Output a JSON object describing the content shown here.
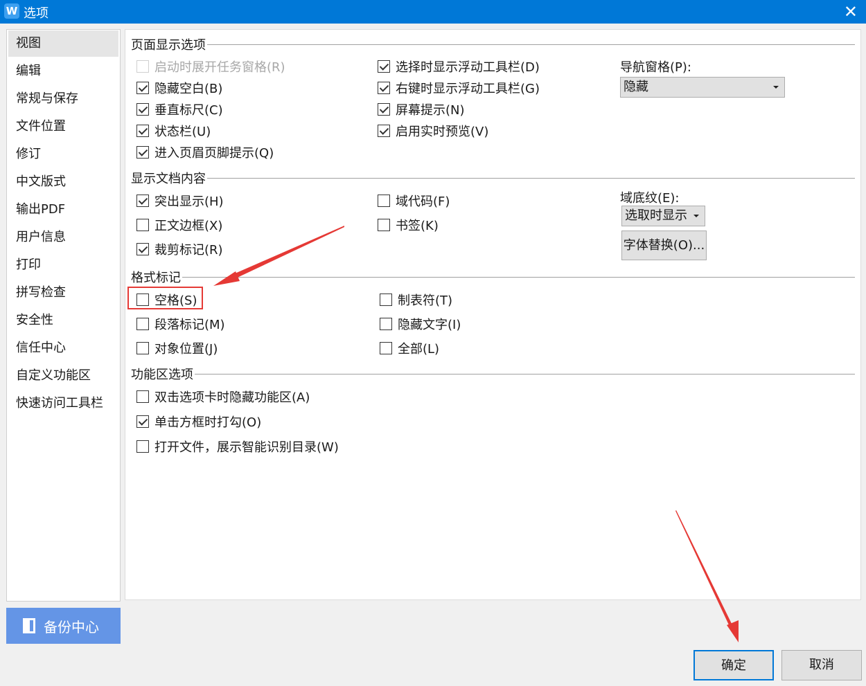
{
  "window": {
    "title": "选项",
    "close": "✕",
    "app_icon": "W"
  },
  "sidebar": {
    "items": [
      {
        "label": "视图",
        "selected": true
      },
      {
        "label": "编辑"
      },
      {
        "label": "常规与保存"
      },
      {
        "label": "文件位置"
      },
      {
        "label": "修订"
      },
      {
        "label": "中文版式"
      },
      {
        "label": "输出PDF"
      },
      {
        "label": "用户信息"
      },
      {
        "label": "打印"
      },
      {
        "label": "拼写检查"
      },
      {
        "label": "安全性"
      },
      {
        "label": "信任中心"
      },
      {
        "label": "自定义功能区"
      },
      {
        "label": "快速访问工具栏"
      }
    ]
  },
  "page_display": {
    "title": "页面显示选项",
    "left": [
      {
        "label": "启动时展开任务窗格(R)",
        "checked": false,
        "disabled": true
      },
      {
        "label": "隐藏空白(B)",
        "checked": true
      },
      {
        "label": "垂直标尺(C)",
        "checked": true
      },
      {
        "label": "状态栏(U)",
        "checked": true
      },
      {
        "label": "进入页眉页脚提示(Q)",
        "checked": true
      }
    ],
    "right": [
      {
        "label": "选择时显示浮动工具栏(D)",
        "checked": true
      },
      {
        "label": "右键时显示浮动工具栏(G)",
        "checked": true
      },
      {
        "label": "屏幕提示(N)",
        "checked": true
      },
      {
        "label": "启用实时预览(V)",
        "checked": true
      }
    ],
    "nav_pane_label": "导航窗格(P):",
    "nav_pane_value": "隐藏"
  },
  "doc_content": {
    "title": "显示文档内容",
    "left": [
      {
        "label": "突出显示(H)",
        "checked": true
      },
      {
        "label": "正文边框(X)",
        "checked": false
      },
      {
        "label": "裁剪标记(R)",
        "checked": true
      }
    ],
    "right": [
      {
        "label": "域代码(F)",
        "checked": false
      },
      {
        "label": "书签(K)",
        "checked": false
      }
    ],
    "field_shading_label": "域底纹(E):",
    "field_shading_value": "选取时显示",
    "font_sub_button": "字体替换(O)..."
  },
  "format_marks": {
    "title": "格式标记",
    "left": [
      {
        "label": "空格(S)",
        "checked": false
      },
      {
        "label": "段落标记(M)",
        "checked": false
      },
      {
        "label": "对象位置(J)",
        "checked": false
      }
    ],
    "right": [
      {
        "label": "制表符(T)",
        "checked": false
      },
      {
        "label": "隐藏文字(I)",
        "checked": false
      },
      {
        "label": "全部(L)",
        "checked": false
      }
    ]
  },
  "ribbon": {
    "title": "功能区选项",
    "items": [
      {
        "label": "双击选项卡时隐藏功能区(A)",
        "checked": false
      },
      {
        "label": "单击方框时打勾(O)",
        "checked": true
      },
      {
        "label": "打开文件，展示智能识别目录(W)",
        "checked": false
      }
    ]
  },
  "footer": {
    "backup": "备份中心",
    "ok": "确定",
    "cancel": "取消"
  },
  "colors": {
    "titlebar": "#0078d7",
    "backup": "#6495e6",
    "annotation": "#e53935"
  }
}
